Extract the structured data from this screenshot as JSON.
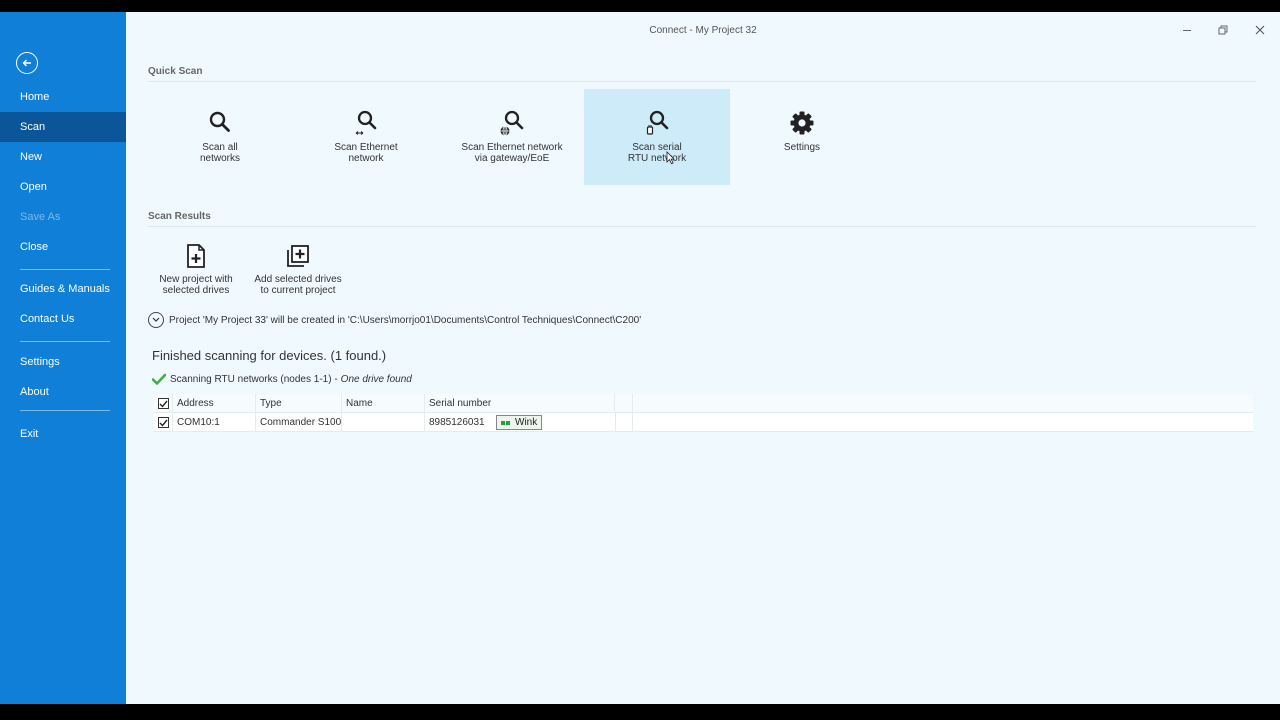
{
  "window": {
    "title": "Connect - My Project 32",
    "controls": [
      "minimize-icon",
      "restore-icon",
      "close-icon"
    ]
  },
  "sidebar": {
    "back_icon": "arrow-left-circle-icon",
    "items": [
      {
        "label": "Home"
      },
      {
        "label": "Scan",
        "active": true
      },
      {
        "label": "New"
      },
      {
        "label": "Open"
      },
      {
        "label": "Save As",
        "disabled": true
      },
      {
        "label": "Close"
      },
      {
        "label": "Guides & Manuals"
      },
      {
        "label": "Contact Us"
      },
      {
        "label": "Settings"
      },
      {
        "label": "About"
      },
      {
        "label": "Exit"
      }
    ]
  },
  "quick_scan": {
    "title": "Quick Scan",
    "tiles": [
      {
        "label": "Scan all\nnetworks",
        "icon": "search-icon"
      },
      {
        "label": "Scan Ethernet\nnetwork",
        "icon": "search-ethernet-icon"
      },
      {
        "label": "Scan Ethernet network\nvia gateway/EoE",
        "icon": "search-globe-icon"
      },
      {
        "label": "Scan serial\nRTU network",
        "icon": "search-serial-icon",
        "hovered": true
      },
      {
        "label": "Settings",
        "icon": "gear-icon"
      }
    ]
  },
  "scan_results": {
    "title": "Scan Results",
    "actions": [
      {
        "label": "New project with\nselected drives",
        "icon": "new-document-plus-icon"
      },
      {
        "label": "Add selected drives\nto current project",
        "icon": "add-to-stack-icon"
      }
    ],
    "info": "Project 'My Project 33' will be created in 'C:\\Users\\morrjo01\\Documents\\Control Techniques\\Connect\\C200'",
    "finished": "Finished scanning for devices. (1 found.)",
    "scan_line": {
      "text": "Scanning RTU networks (nodes 1-1) -",
      "result": "One drive found"
    },
    "table": {
      "headers": [
        "Address",
        "Type",
        "Name",
        "Serial number"
      ],
      "rows": [
        {
          "address": "COM10:1",
          "type": "Commander S100",
          "name": "",
          "serial": "8985126031",
          "checked": true
        }
      ],
      "wink_label": "Wink"
    }
  },
  "colors": {
    "sidebar": "#0f7fd8",
    "sidebar_active": "#0b5698",
    "background": "#f0f9fd",
    "tile_hover": "#cdebf9",
    "check_green": "#3fae48"
  }
}
